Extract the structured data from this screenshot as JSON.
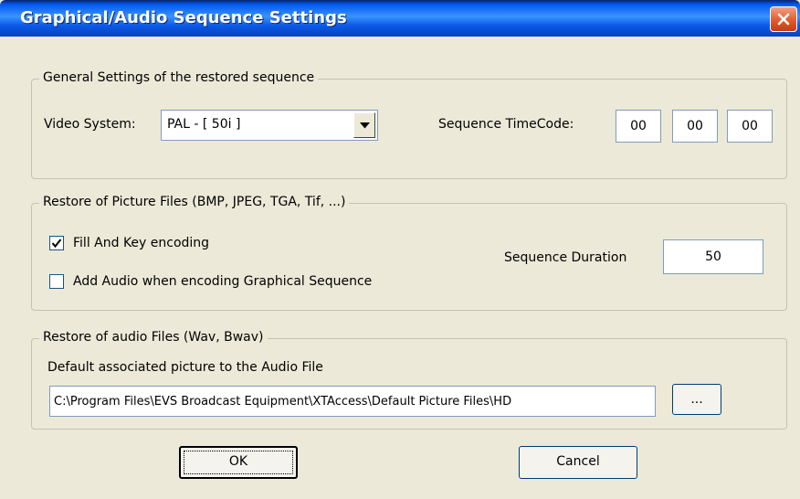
{
  "window": {
    "title": "Graphical/Audio Sequence Settings"
  },
  "general": {
    "legend": "General Settings of the restored sequence",
    "video_system_label": "Video System:",
    "video_system_value": "PAL - [ 50i ]",
    "timecode_label": "Sequence TimeCode:",
    "timecode": [
      "00",
      "00",
      "00"
    ]
  },
  "picture": {
    "legend": "Restore of Picture Files (BMP, JPEG, TGA, Tif, ...)",
    "fill_key_label": "Fill And Key encoding",
    "fill_key_checked": true,
    "add_audio_label": "Add Audio when encoding Graphical Sequence",
    "add_audio_checked": false,
    "duration_label": "Sequence Duration",
    "duration_value": "50"
  },
  "audio": {
    "legend": "Restore of audio Files (Wav, Bwav)",
    "default_picture_label": "Default associated picture to the Audio File",
    "default_picture_path": "C:\\Program Files\\EVS Broadcast Equipment\\XTAccess\\Default Picture Files\\HD",
    "browse_label": "..."
  },
  "buttons": {
    "ok": "OK",
    "cancel": "Cancel"
  }
}
